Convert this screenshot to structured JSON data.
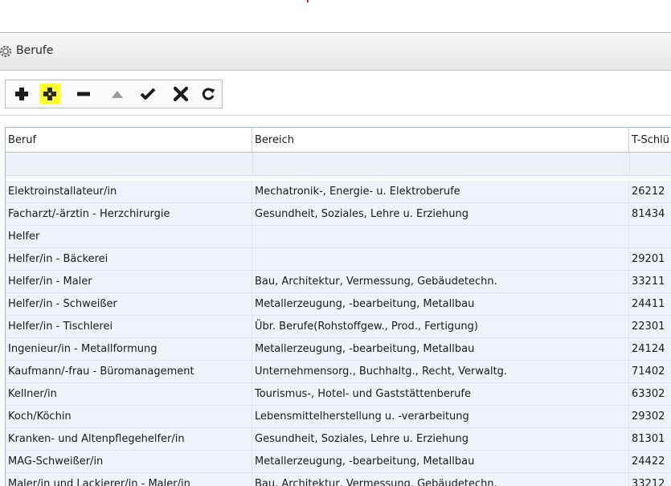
{
  "window": {
    "title": "Berufe"
  },
  "toolbar": {
    "buttons": [
      {
        "name": "add",
        "icon": "plus-icon",
        "state": "enabled"
      },
      {
        "name": "add-copy",
        "icon": "plus-icon",
        "state": "highlighted"
      },
      {
        "name": "remove",
        "icon": "minus-icon",
        "state": "enabled"
      },
      {
        "name": "move-up",
        "icon": "triangle-up-icon",
        "state": "disabled"
      },
      {
        "name": "confirm",
        "icon": "check-icon",
        "state": "enabled"
      },
      {
        "name": "cancel",
        "icon": "x-icon",
        "state": "enabled"
      },
      {
        "name": "refresh",
        "icon": "refresh-icon",
        "state": "enabled"
      }
    ]
  },
  "grid": {
    "columns": [
      "Beruf",
      "Bereich",
      "T-Schlü"
    ],
    "rows": [
      [
        "Elektroinstallateur/in",
        "Mechatronik-, Energie- u. Elektroberufe",
        "26212"
      ],
      [
        "Facharzt/-ärztin - Herzchirurgie",
        "Gesundheit, Soziales, Lehre u. Erziehung",
        "81434"
      ],
      [
        "Helfer",
        "",
        ""
      ],
      [
        "Helfer/in - Bäckerei",
        "",
        "29201"
      ],
      [
        "Helfer/in - Maler",
        "Bau, Architektur, Vermessung, Gebäudetechn.",
        "33211"
      ],
      [
        "Helfer/in - Schweißer",
        "Metallerzeugung, -bearbeitung, Metallbau",
        "24411"
      ],
      [
        "Helfer/in - Tischlerei",
        "Übr. Berufe(Rohstoffgew., Prod., Fertigung)",
        "22301"
      ],
      [
        "Ingenieur/in - Metallformung",
        "Metallerzeugung, -bearbeitung, Metallbau",
        "24124"
      ],
      [
        "Kaufmann/-frau - Büromanagement",
        "Unternehmensorg., Buchhaltg., Recht, Verwaltg.",
        "71402"
      ],
      [
        "Kellner/in",
        "Tourismus-, Hotel- und Gaststättenberufe",
        "63302"
      ],
      [
        "Koch/Köchin",
        "Lebensmittelherstellung u. -verarbeitung",
        "29302"
      ],
      [
        "Kranken- und Altenpflegehelfer/in",
        "Gesundheit, Soziales, Lehre u. Erziehung",
        "81301"
      ],
      [
        "MAG-Schweißer/in",
        "Metallerzeugung, -bearbeitung, Metallbau",
        "24422"
      ],
      [
        "Maler/in und Lackierer/in - Maler/in",
        "Bau, Architektur, Vermessung, Gebäudetechn.",
        "33212"
      ]
    ]
  },
  "colors": {
    "highlight": "#ffff2e",
    "row_bg": "#eef2f9",
    "header_border": "#b7c3d0"
  }
}
